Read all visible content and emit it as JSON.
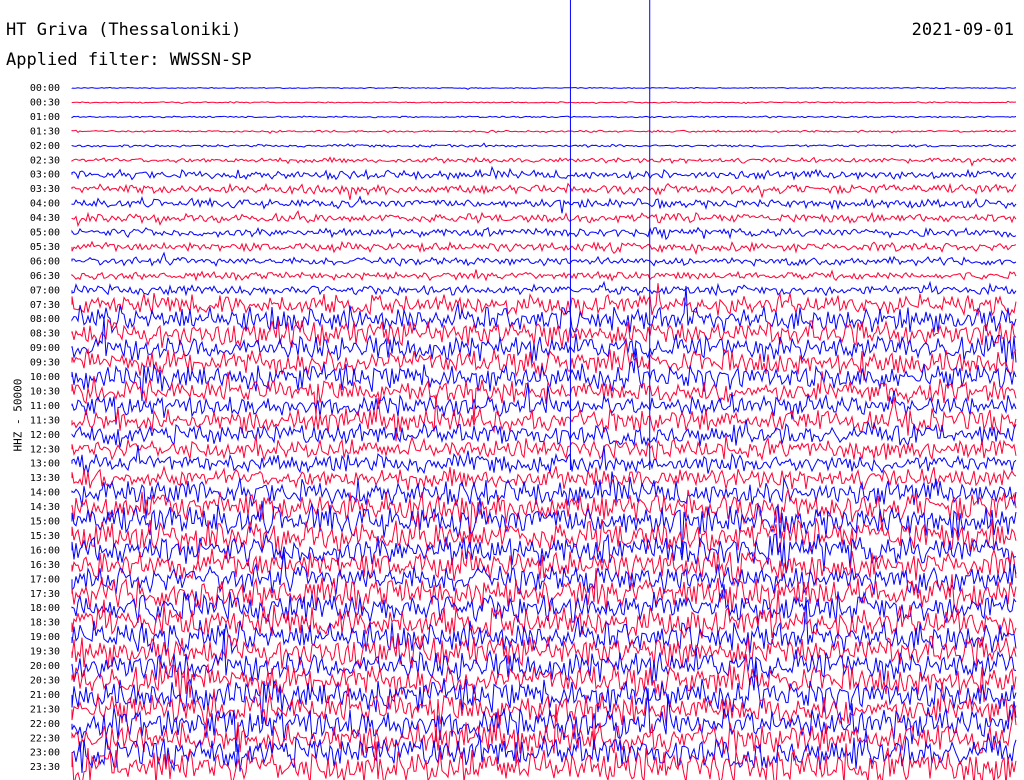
{
  "header": {
    "station": "HT Griva (Thessaloniki)",
    "date": "2021-09-01",
    "filter": "Applied filter: WWSSN-SP"
  },
  "chart_data": {
    "type": "line",
    "ylabel": "HHZ - 50000",
    "colors": [
      "#0000ff",
      "#ff0033"
    ],
    "tick_labels": [
      "00:00",
      "00:30",
      "01:00",
      "01:30",
      "02:00",
      "02:30",
      "03:00",
      "03:30",
      "04:00",
      "04:30",
      "05:00",
      "05:30",
      "06:00",
      "06:30",
      "07:00",
      "07:30",
      "08:00",
      "08:30",
      "09:00",
      "09:30",
      "10:00",
      "10:30",
      "11:00",
      "11:30",
      "12:00",
      "12:30",
      "13:00",
      "13:30",
      "14:00",
      "14:30",
      "15:00",
      "15:30",
      "16:00",
      "16:30",
      "17:00",
      "17:30",
      "18:00",
      "18:30",
      "19:00",
      "19:30",
      "20:00",
      "20:30",
      "21:00",
      "21:30",
      "22:00",
      "22:30",
      "23:00",
      "23:30"
    ],
    "trace_noise_level": [
      0.4,
      0.5,
      0.6,
      0.8,
      1.0,
      2.0,
      3.5,
      3.8,
      3.5,
      3.5,
      3.5,
      3.5,
      3.2,
      3.0,
      4.0,
      8.0,
      10.0,
      10.0,
      10.0,
      10.0,
      10.0,
      9.0,
      8.0,
      9.0,
      8.0,
      8.0,
      7.0,
      8.0,
      10.0,
      12.0,
      12.0,
      12.0,
      12.0,
      11.0,
      11.0,
      12.0,
      12.0,
      12.0,
      12.0,
      12.0,
      12.0,
      12.0,
      12.0,
      12.0,
      12.0,
      12.0,
      12.0,
      14.0
    ],
    "time_markers_fraction": [
      0.528,
      0.612
    ]
  }
}
